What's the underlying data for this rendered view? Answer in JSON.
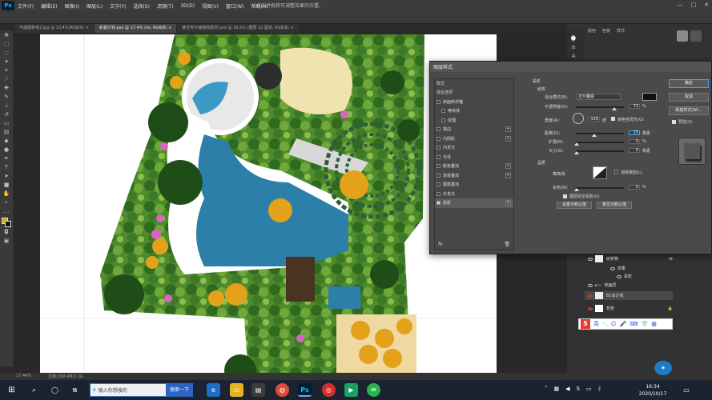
{
  "app": {
    "logo": "Ps",
    "menu": [
      "文件(F)",
      "编辑(E)",
      "图像(I)",
      "图层(L)",
      "文字(Y)",
      "选择(S)",
      "滤镜(T)",
      "3D(D)",
      "视图(V)",
      "窗口(W)",
      "帮助(H)"
    ],
    "center_title": "点击并拖移可调整效果的位置。",
    "window_controls": [
      "—",
      "□",
      "✕"
    ]
  },
  "doc_tabs": [
    {
      "label": "平面图参考2.jpg @ 13.4%(RGB/8) ×",
      "active": false
    },
    {
      "label": "彩装计划.psd @ 17.4% (lvl, RGB/8) ×",
      "active": true
    },
    {
      "label": "某住宅平面植物素材.psd @ 16.5% (图层 22 副本, RGB/8) ×",
      "active": false
    }
  ],
  "status": {
    "zoom": "17.44%",
    "doc": "文档:199.4M/2.1G"
  },
  "panel_tabs": [
    "颜色",
    "色板",
    "样式"
  ],
  "dialog": {
    "title": "图层样式",
    "left_header": "样式",
    "blend_options": "混合选项",
    "style_items": [
      {
        "label": "斜面和浮雕",
        "checked": false,
        "plus": false
      },
      {
        "label": "等高线",
        "checked": false,
        "plus": false
      },
      {
        "label": "纹理",
        "checked": false,
        "plus": false
      },
      {
        "label": "描边",
        "checked": false,
        "plus": true
      },
      {
        "label": "内阴影",
        "checked": false,
        "plus": true
      },
      {
        "label": "内发光",
        "checked": false,
        "plus": false
      },
      {
        "label": "光泽",
        "checked": false,
        "plus": false
      },
      {
        "label": "颜色叠加",
        "checked": false,
        "plus": true
      },
      {
        "label": "渐变叠加",
        "checked": false,
        "plus": true
      },
      {
        "label": "图案叠加",
        "checked": false,
        "plus": false
      },
      {
        "label": "外发光",
        "checked": false,
        "plus": false
      },
      {
        "label": "投影",
        "checked": true,
        "plus": true
      }
    ],
    "fx_label": "fx",
    "section_title": "投影",
    "structure_label": "结构",
    "blend_mode_label": "混合模式(B):",
    "blend_mode_value": "正片叠底",
    "opacity_label": "不透明度(O):",
    "opacity_value": "72",
    "angle_label": "角度(A):",
    "angle_value": "126",
    "angle_unit": "度",
    "global_light_label": "使用全局光(G)",
    "distance_label": "距离(D):",
    "distance_value": "25",
    "spread_label": "扩展(R):",
    "spread_value": "0",
    "size_label": "大小(S):",
    "size_value": "0",
    "px_unit": "像素",
    "percent": "%",
    "quality_label": "品质",
    "contour_label": "等高线:",
    "antialias_label": "消除锯齿(L)",
    "noise_label": "杂色(N):",
    "noise_value": "0",
    "knockout_label": "图层挖空投影(U)",
    "default_btn": "设置为默认值",
    "reset_btn": "复位为默认值",
    "ok": "确定",
    "cancel": "取消",
    "new_style": "新建样式(W)...",
    "preview": "预览(V)"
  },
  "layers": [
    {
      "name": "树状物",
      "thumb": "#e6e6e6"
    },
    {
      "name": "效果",
      "thumb": ""
    },
    {
      "name": "投影",
      "thumb": ""
    },
    {
      "name": "地面层",
      "thumb": "#888888"
    },
    {
      "name": "81设计线",
      "thumb": "#e6e6e6"
    },
    {
      "name": "背景",
      "thumb": "#ffffff"
    }
  ],
  "ime": {
    "logo": "S",
    "mode": "英"
  },
  "taskbar": {
    "search_placeholder": "输入你想搜的",
    "search_button": "搜索一下",
    "time": "16:34",
    "date": "2020/10/17",
    "ps_label": "Ps"
  },
  "colors": {
    "accent": "#31a8ff",
    "shadow_color": "#111111",
    "water": "#2b7fa8"
  }
}
